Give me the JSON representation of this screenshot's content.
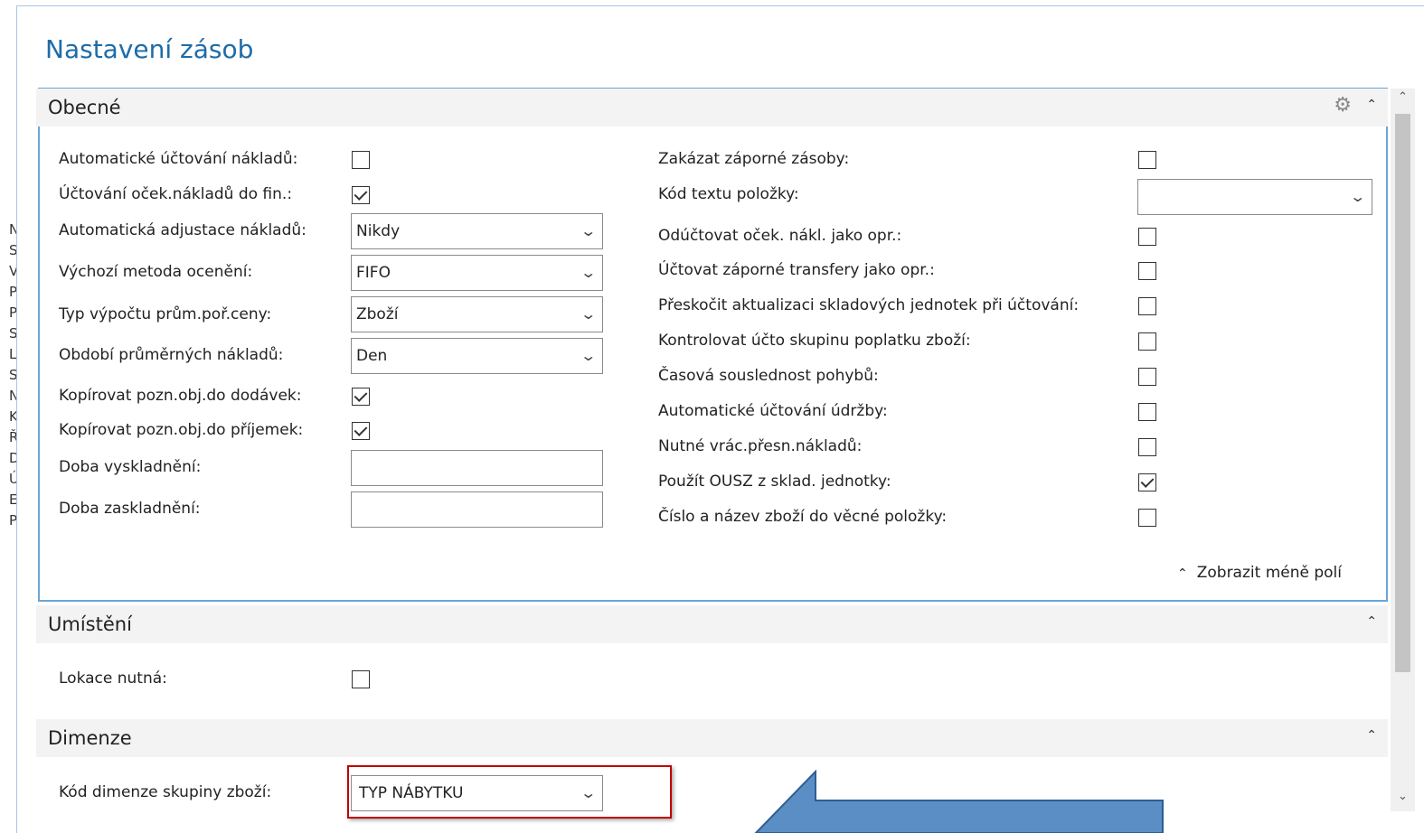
{
  "page": {
    "title": "Nastavení zásob"
  },
  "background_letters": [
    "N",
    "S",
    "V",
    "P",
    "P",
    "S",
    "L",
    "S",
    "N",
    "K",
    "Ř",
    "D",
    "Ú",
    "E",
    "P"
  ],
  "general": {
    "title": "Obecné",
    "left_fields": [
      {
        "label": "Automatické účtování nákladů:",
        "type": "checkbox",
        "checked": false
      },
      {
        "label": "Účtování oček.nákladů do fin.:",
        "type": "checkbox",
        "checked": true
      },
      {
        "label": "Automatická adjustace nákladů:",
        "type": "select",
        "value": "Nikdy"
      },
      {
        "label": "Výchozí metoda ocenění:",
        "type": "select",
        "value": "FIFO"
      },
      {
        "label": "Typ výpočtu prům.poř.ceny:",
        "type": "select",
        "value": "Zboží"
      },
      {
        "label": "Období průměrných nákladů:",
        "type": "select",
        "value": "Den"
      },
      {
        "label": "Kopírovat pozn.obj.do dodávek:",
        "type": "checkbox",
        "checked": true
      },
      {
        "label": "Kopírovat pozn.obj.do příjemek:",
        "type": "checkbox",
        "checked": true
      },
      {
        "label": "Doba vyskladnění:",
        "type": "text",
        "value": ""
      },
      {
        "label": "Doba zaskladnění:",
        "type": "text",
        "value": ""
      }
    ],
    "right_fields": [
      {
        "label": "Zakázat záporné zásoby:",
        "type": "checkbox",
        "checked": false
      },
      {
        "label": "Kód textu položky:",
        "type": "select",
        "value": ""
      },
      {
        "label": "Odúčtovat oček. nákl. jako opr.:",
        "type": "checkbox",
        "checked": false
      },
      {
        "label": "Účtovat záporné transfery jako opr.:",
        "type": "checkbox",
        "checked": false
      },
      {
        "label": "Přeskočit aktualizaci skladových jednotek při účtování:",
        "type": "checkbox",
        "checked": false
      },
      {
        "label": "Kontrolovat účto skupinu poplatku zboží:",
        "type": "checkbox",
        "checked": false
      },
      {
        "label": "Časová souslednost pohybů:",
        "type": "checkbox",
        "checked": false
      },
      {
        "label": "Automatické účtování údržby:",
        "type": "checkbox",
        "checked": false
      },
      {
        "label": "Nutné vrác.přesn.nákladů:",
        "type": "checkbox",
        "checked": false
      },
      {
        "label": "Použít OUSZ z sklad. jednotky:",
        "type": "checkbox",
        "checked": true
      },
      {
        "label": "Číslo a název zboží do věcné položky:",
        "type": "checkbox",
        "checked": false
      }
    ],
    "show_less_label": "Zobrazit méně polí"
  },
  "location": {
    "title": "Umístění",
    "fields": [
      {
        "label": "Lokace nutná:",
        "type": "checkbox",
        "checked": false
      }
    ]
  },
  "dimensions": {
    "title": "Dimenze",
    "fields": [
      {
        "label": "Kód dimenze skupiny zboží:",
        "type": "select",
        "value": "TYP NÁBYTKU"
      }
    ]
  },
  "icons": {
    "collapse": "chevron-up-icon",
    "dropdown": "chevron-down-icon",
    "settings": "gears-icon",
    "scroll_up": "scroll-up-icon",
    "scroll_down": "scroll-down-icon"
  },
  "colors": {
    "title": "#1d6ca8",
    "fasttab_border": "#6aa6d8",
    "highlight": "#c00000",
    "arrow_fill": "#5b8ec4",
    "arrow_stroke": "#2f5e93"
  }
}
